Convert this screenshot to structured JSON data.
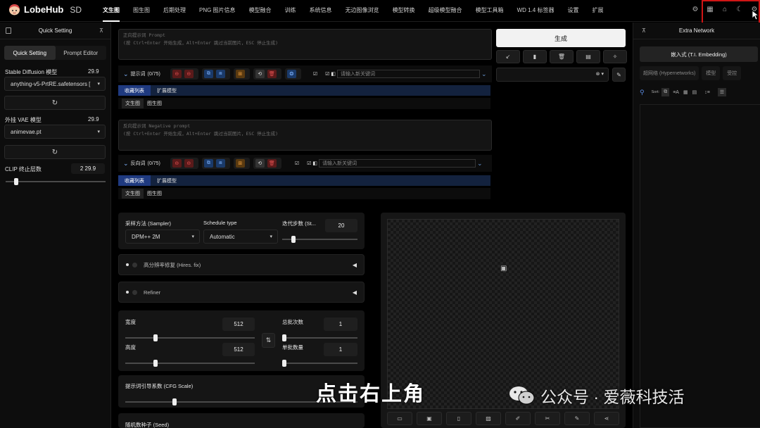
{
  "app": {
    "logo_name": "LobeHub",
    "logo_suffix": "SD"
  },
  "tabs": [
    "文生图",
    "图生图",
    "后期处理",
    "PNG 图片信息",
    "模型融合",
    "训练",
    "系统信息",
    "无边图像浏览",
    "模型转换",
    "超级模型融合",
    "模型工具箱",
    "WD 1.4 标签器",
    "设置",
    "扩展"
  ],
  "left_panel": {
    "title": "Quick Setting",
    "seg_quick": "Quick Setting",
    "seg_prompt": "Prompt Editor",
    "sd_model_label": "Stable Diffusion 模型",
    "sd_model_value": "anything-v5-PrtRE.safetensors [",
    "sd_model_version": "29.9",
    "vae_label": "外挂 VAE 模型",
    "vae_value": "animevae.pt",
    "vae_version": "29.9",
    "clip_label": "CLIP 终止层数",
    "clip_value": "2 29.9"
  },
  "prompt": {
    "placeholder_line1": "正向提示词 Prompt",
    "placeholder_line2": "(按 Ctrl+Enter 开始生成，Alt+Enter 跳过当前图片，ESC 停止生成)",
    "tag_label": "提示词",
    "count": "(0/75)",
    "kw_placeholder": "请输入新关键词",
    "list_tab1": "收藏列表",
    "list_tab2": "扩展模型",
    "sub1": "文生图",
    "sub2": "图生图"
  },
  "negative": {
    "placeholder_line1": "反向提示词 Negative prompt",
    "placeholder_line2": "(按 Ctrl+Enter 开始生成，Alt+Enter 跳过当前图片，ESC 停止生成)",
    "tag_label": "反向词",
    "count": "(0/75)",
    "kw_placeholder": "请输入新关键词",
    "list_tab1": "收藏列表",
    "list_tab2": "扩展模型",
    "sub1": "文生图",
    "sub2": "图生图"
  },
  "sampler": {
    "method_label": "采样方法 (Sampler)",
    "method_value": "DPM++ 2M",
    "schedule_label": "Schedule type",
    "schedule_value": "Automatic",
    "steps_label": "迭代步数 (St...",
    "steps_value": "20"
  },
  "hires_label": "高分辨率修复 (Hires. fix)",
  "refiner_label": "Refiner",
  "size": {
    "width_label": "宽度",
    "width_value": "512",
    "height_label": "高度",
    "height_value": "512",
    "batch_count_label": "总批次数",
    "batch_count_value": "1",
    "batch_size_label": "单批数量",
    "batch_size_value": "1"
  },
  "cfg_label": "提示词引导系数 (CFG Scale)",
  "seed_label": "随机数种子 (Seed)",
  "generate_label": "生成",
  "right_panel": {
    "title": "Extra Network",
    "tab_embedding": "嵌入式 (T.I. Embedding)",
    "tab_hyper": "超网络 (Hypernetworks)",
    "tab_model": "模型",
    "tab_lora": "受控",
    "sort_label": "Sort:"
  },
  "overlay": {
    "subtitle": "点击右上角",
    "watermark": "公众号 · 爱薇科技活"
  },
  "colors": {
    "highlight": "#d01515",
    "list_selected": "#1f3a80"
  }
}
